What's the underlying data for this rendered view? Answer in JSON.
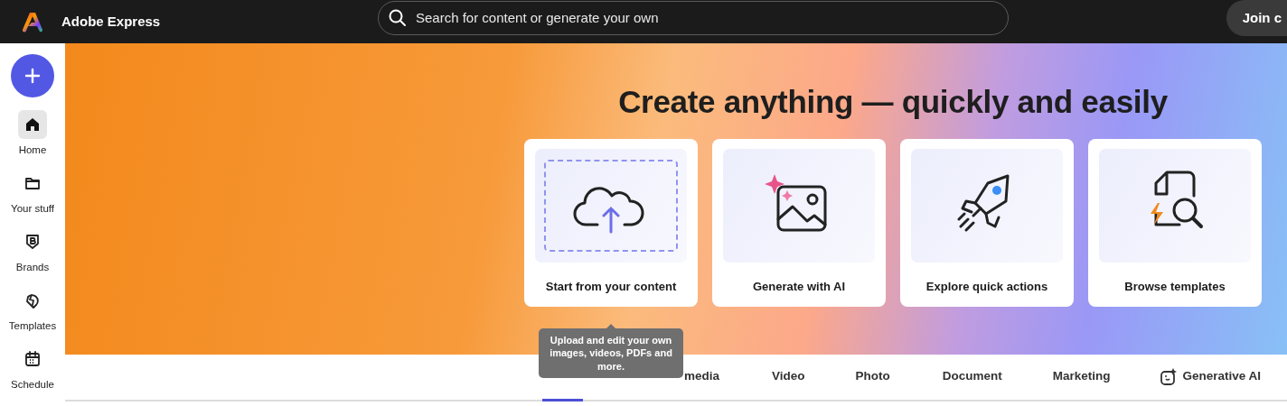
{
  "header": {
    "app_name": "Adobe Express",
    "search": {
      "placeholder": "Search for content or generate your own"
    },
    "join_button": "Join c"
  },
  "sidebar": {
    "items": [
      {
        "label": "Home",
        "selected": true
      },
      {
        "label": "Your stuff",
        "selected": false
      },
      {
        "label": "Brands",
        "selected": false
      },
      {
        "label": "Templates",
        "selected": false
      },
      {
        "label": "Schedule",
        "selected": false
      }
    ]
  },
  "hero": {
    "heading": "Create anything — quickly and easily",
    "cards": [
      {
        "label": "Start from your content"
      },
      {
        "label": "Generate with AI"
      },
      {
        "label": "Explore quick actions"
      },
      {
        "label": "Browse templates"
      }
    ]
  },
  "tooltip": "Upload and edit your own images, videos, PDFs and more.",
  "tabs": [
    {
      "selected": true
    },
    {
      "label": "media",
      "selected": false
    },
    {
      "label": "Video",
      "selected": false
    },
    {
      "label": "Photo",
      "selected": false
    },
    {
      "label": "Document",
      "selected": false
    },
    {
      "label": "Marketing",
      "selected": false
    },
    {
      "label": "Generative AI",
      "selected": false
    }
  ]
}
